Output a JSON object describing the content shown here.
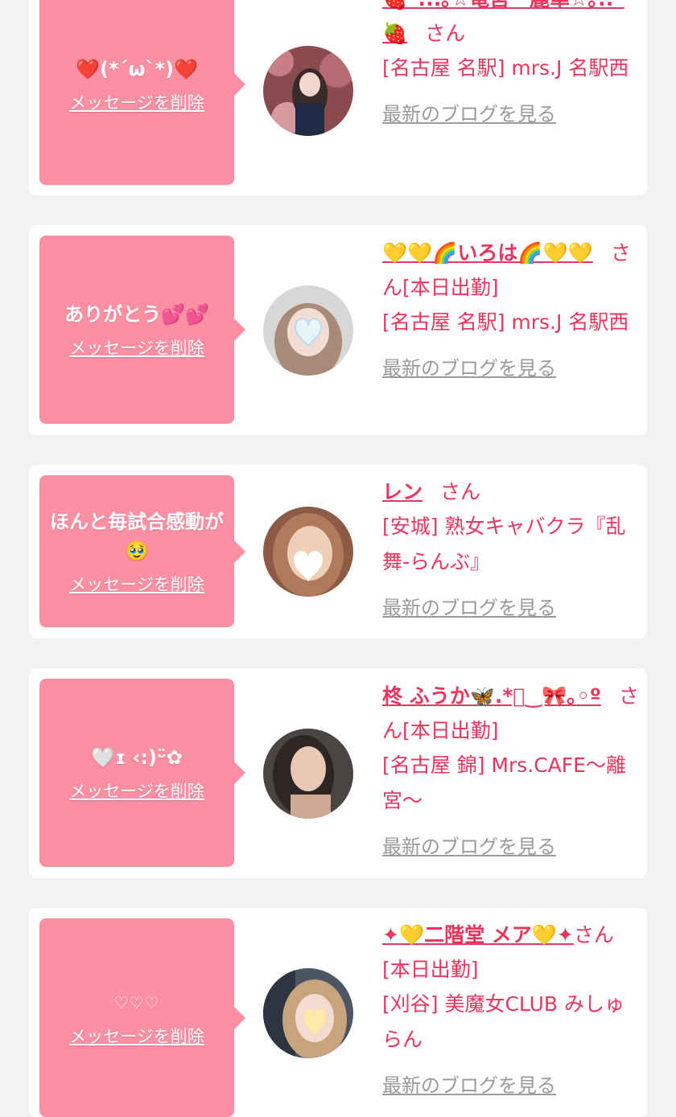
{
  "delete_label": "メッセージを削除",
  "blog_label": "最新のブログを見る",
  "honorific": "さん",
  "cards": [
    {
      "message": "❤️(*´ω`*)❤️",
      "name": "🍓*:..｡☆竜宮　麗華☆｡.:*🍓",
      "badge": "",
      "shop": "[名古屋 名駅] mrs.J 名駅西"
    },
    {
      "message": "ありがとう💕💕",
      "name": "💛💛🌈いろは🌈💛💛",
      "badge": "[本日出勤]",
      "shop": "[名古屋 名駅] mrs.J 名駅西"
    },
    {
      "message": "ほんと毎試合感動が🥹",
      "name": "レン",
      "badge": "",
      "shop": "[安城] 熟女キャバクラ『乱舞-らんぶ』"
    },
    {
      "message": "🤍ɪ ‹:)ᵕ̈✿",
      "name": "柊 ふうか🦋.*ﾟ‿🎀｡◦º",
      "badge": "[本日出勤]",
      "shop": "[名古屋 錦] Mrs.CAFE〜離宮〜"
    },
    {
      "message": "♡♡♡",
      "name": "✦💛二階堂 メア💛✦",
      "badge": "[本日出勤]",
      "shop": "[刈谷] 美魔女CLUB みしゅらん"
    }
  ],
  "colors": {
    "accent": "#e8365d",
    "bubble": "#fd8fa3",
    "link_gray": "#9a9a9a",
    "background": "#f2f2f2"
  }
}
